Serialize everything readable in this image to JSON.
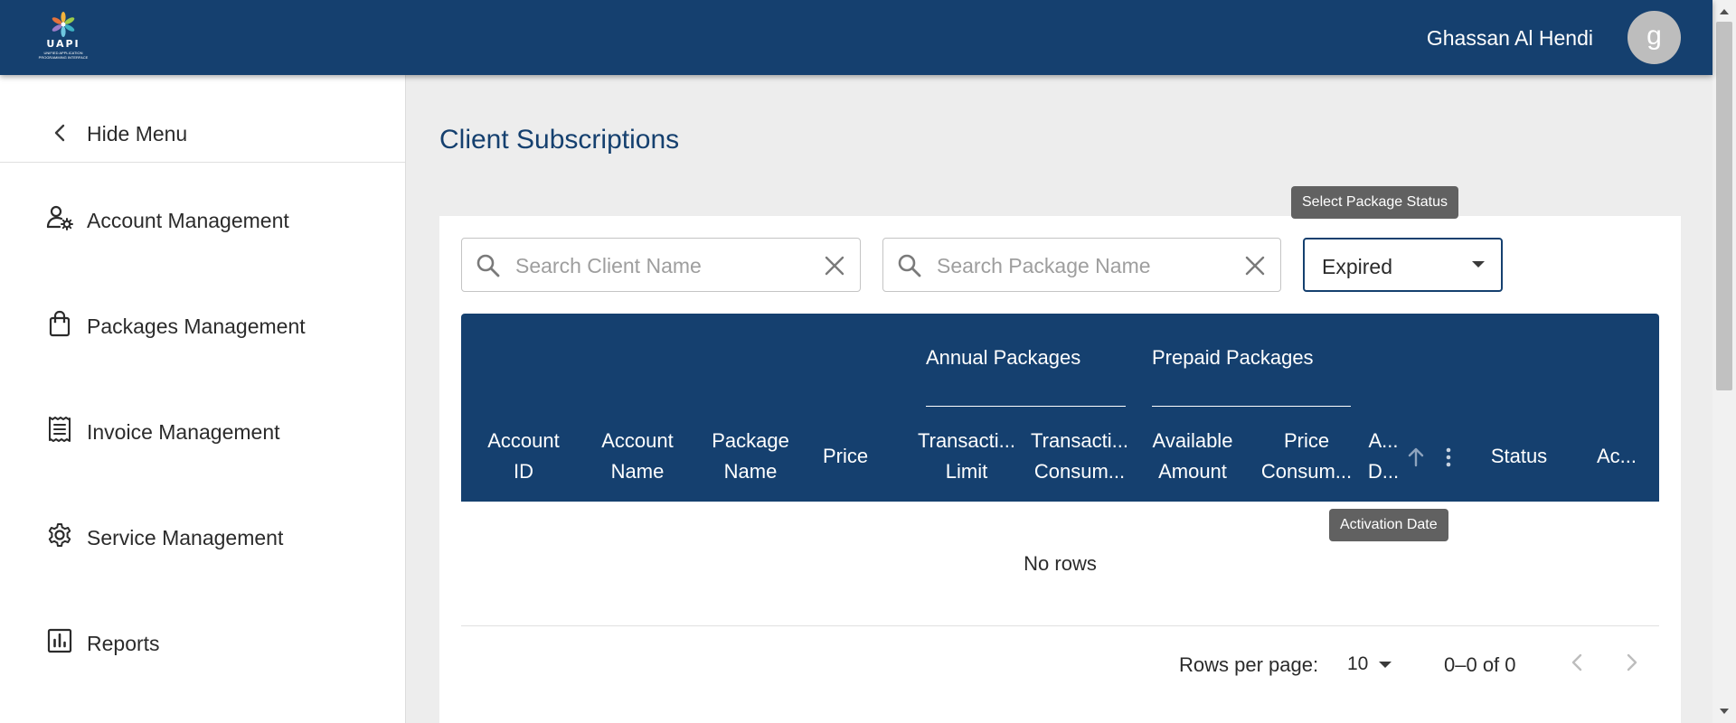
{
  "brand": {
    "logo_text": "UAPI",
    "logo_subtitle": "UNIFIED APPLICATION PROGRAMMING INTERFACE"
  },
  "header": {
    "user_name": "Ghassan Al Hendi",
    "avatar_initial": "g"
  },
  "sidebar": {
    "hide_menu_label": "Hide Menu",
    "items": [
      {
        "label": "Account Management",
        "icon": "user-gear-icon"
      },
      {
        "label": "Packages Management",
        "icon": "shopping-bag-icon"
      },
      {
        "label": "Invoice Management",
        "icon": "receipt-icon"
      },
      {
        "label": "Service Management",
        "icon": "gear-icon"
      },
      {
        "label": "Reports",
        "icon": "bar-chart-icon"
      }
    ]
  },
  "page": {
    "title": "Client Subscriptions"
  },
  "filters": {
    "client_search_placeholder": "Search Client Name",
    "package_search_placeholder": "Search Package Name",
    "status_tooltip": "Select Package Status",
    "status_value": "Expired"
  },
  "table": {
    "group_headers": {
      "annual": "Annual Packages",
      "prepaid": "Prepaid Packages"
    },
    "columns": [
      {
        "line1": "Account",
        "line2": "ID"
      },
      {
        "line1": "Account",
        "line2": "Name"
      },
      {
        "line1": "Package",
        "line2": "Name"
      },
      {
        "line1": "Price",
        "line2": ""
      },
      {
        "line1": "Transacti...",
        "line2": "Limit"
      },
      {
        "line1": "Transacti...",
        "line2": "Consum..."
      },
      {
        "line1": "Available",
        "line2": "Amount"
      },
      {
        "line1": "Price",
        "line2": "Consum..."
      },
      {
        "line1": "A...",
        "line2": "D..."
      },
      {
        "line1": "Status",
        "line2": ""
      },
      {
        "line1": "Ac...",
        "line2": ""
      }
    ],
    "column_tooltip": "Activation Date",
    "empty_text": "No rows",
    "pagination": {
      "rows_per_page_label": "Rows per page:",
      "rows_per_page_value": "10",
      "range_text": "0–0 of 0"
    }
  },
  "colors": {
    "primary": "#15406f",
    "tooltip": "#616161",
    "background": "#ededed"
  }
}
